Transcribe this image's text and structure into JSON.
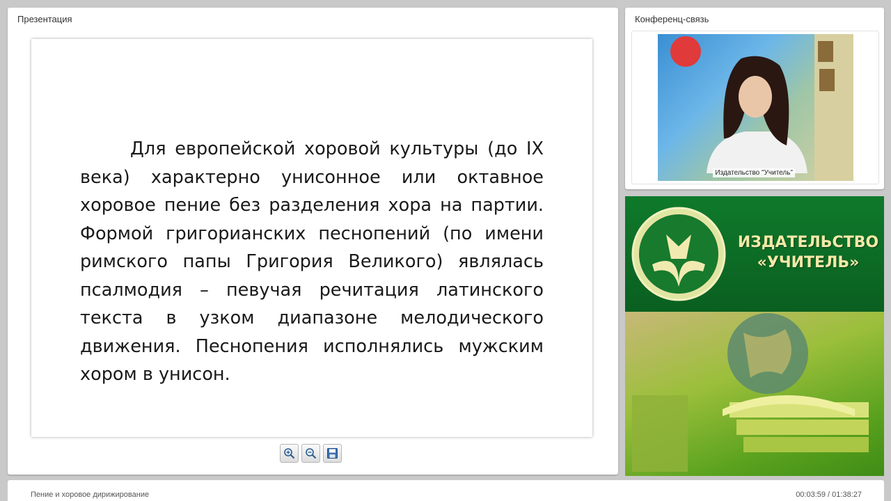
{
  "presentation": {
    "title": "Презентация",
    "slide_text": "Для европейской хоровой культуры (до IX века) характерно унисонное или октавное хоровое пение без разделения хора на партии. Формой григорианских песнопений (по имени римского папы Григория Великого) являлась псалмодия – певучая речитация латинского текста в узком диапазоне мелодического движения. Песнопения исполнялись мужским хором в унисон.",
    "toolbar": [
      "zoom-in-icon",
      "zoom-out-icon",
      "save-icon"
    ]
  },
  "conference": {
    "title": "Конференц-связь",
    "caption": "Издательство \"Учитель\""
  },
  "banner": {
    "publisher_line1": "ИЗДАТЕЛЬСТВО",
    "publisher_line2": "«УЧИТЕЛЬ»"
  },
  "footer": {
    "course_title": "Пение и хоровое дирижирование",
    "time": "00:03:59 / 01:38:27"
  },
  "colors": {
    "banner_green": "#0f7a2b",
    "banner_text": "#f3e9a8"
  }
}
